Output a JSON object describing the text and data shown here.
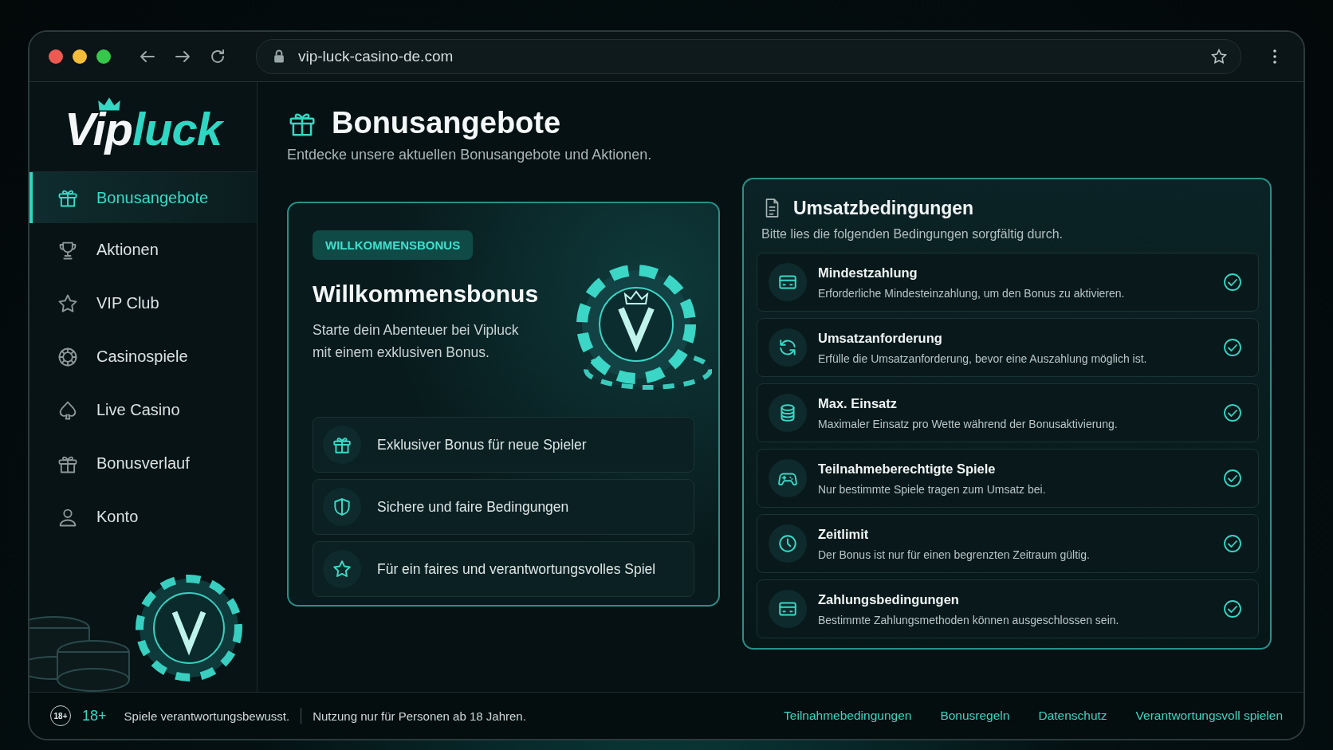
{
  "browser": {
    "url": "vip-luck-casino-de.com"
  },
  "logo": {
    "part_1": "Vip",
    "part_2": "luck"
  },
  "sidebar": {
    "items": [
      {
        "label": "Bonusangebote",
        "selected": true
      },
      {
        "label": "Aktionen",
        "selected": false
      },
      {
        "label": "VIP Club",
        "selected": false
      },
      {
        "label": "Casinospiele",
        "selected": false
      },
      {
        "label": "Live Casino",
        "selected": false
      },
      {
        "label": "Bonusverlauf",
        "selected": false
      },
      {
        "label": "Konto",
        "selected": false
      }
    ]
  },
  "header": {
    "title": "Bonusangebote",
    "subtitle": "Entdecke unsere aktuellen Bonusangebote und Aktionen."
  },
  "welcome": {
    "badge": "WILLKOMMENSBONUS",
    "title": "Willkommensbonus",
    "text": "Starte dein Abenteuer bei Vipluck mit einem exklusiven Bonus.",
    "features": [
      {
        "label": "Exklusiver Bonus für neue Spieler"
      },
      {
        "label": "Sichere und faire Bedingungen"
      },
      {
        "label": "Für ein faires und verantwortungsvolles Spiel"
      }
    ]
  },
  "terms": {
    "title": "Umsatzbedingungen",
    "subtitle": "Bitte lies die folgenden Bedingungen sorgfältig durch.",
    "items": [
      {
        "title": "Mindestzahlung",
        "text": "Erforderliche Mindesteinzahlung, um den Bonus zu aktivieren.",
        "checked": true
      },
      {
        "title": "Umsatzanforderung",
        "text": "Erfülle die Umsatzanforderung, bevor eine Auszahlung möglich ist.",
        "checked": true
      },
      {
        "title": "Max. Einsatz",
        "text": "Maximaler Einsatz pro Wette während der Bonusaktivierung.",
        "checked": true
      },
      {
        "title": "Teilnahmeberechtigte Spiele",
        "text": "Nur bestimmte Spiele tragen zum Umsatz bei.",
        "checked": true
      },
      {
        "title": "Zeitlimit",
        "text": "Der Bonus ist nur für einen begrenzten Zeitraum gültig.",
        "checked": true
      },
      {
        "title": "Zahlungsbedingungen",
        "text": "Bestimmte Zahlungsmethoden können ausgeschlossen sein.",
        "checked": true
      }
    ]
  },
  "footer": {
    "age_icon": "18+",
    "age": "18+",
    "notice_1": "Spiele verantwortungsbewusst.",
    "notice_2": "Nutzung nur für Personen ab 18 Jahren.",
    "links": [
      "Teilnahmebedingungen",
      "Bonusregeln",
      "Datenschutz",
      "Verantwortungsvoll spielen"
    ]
  }
}
